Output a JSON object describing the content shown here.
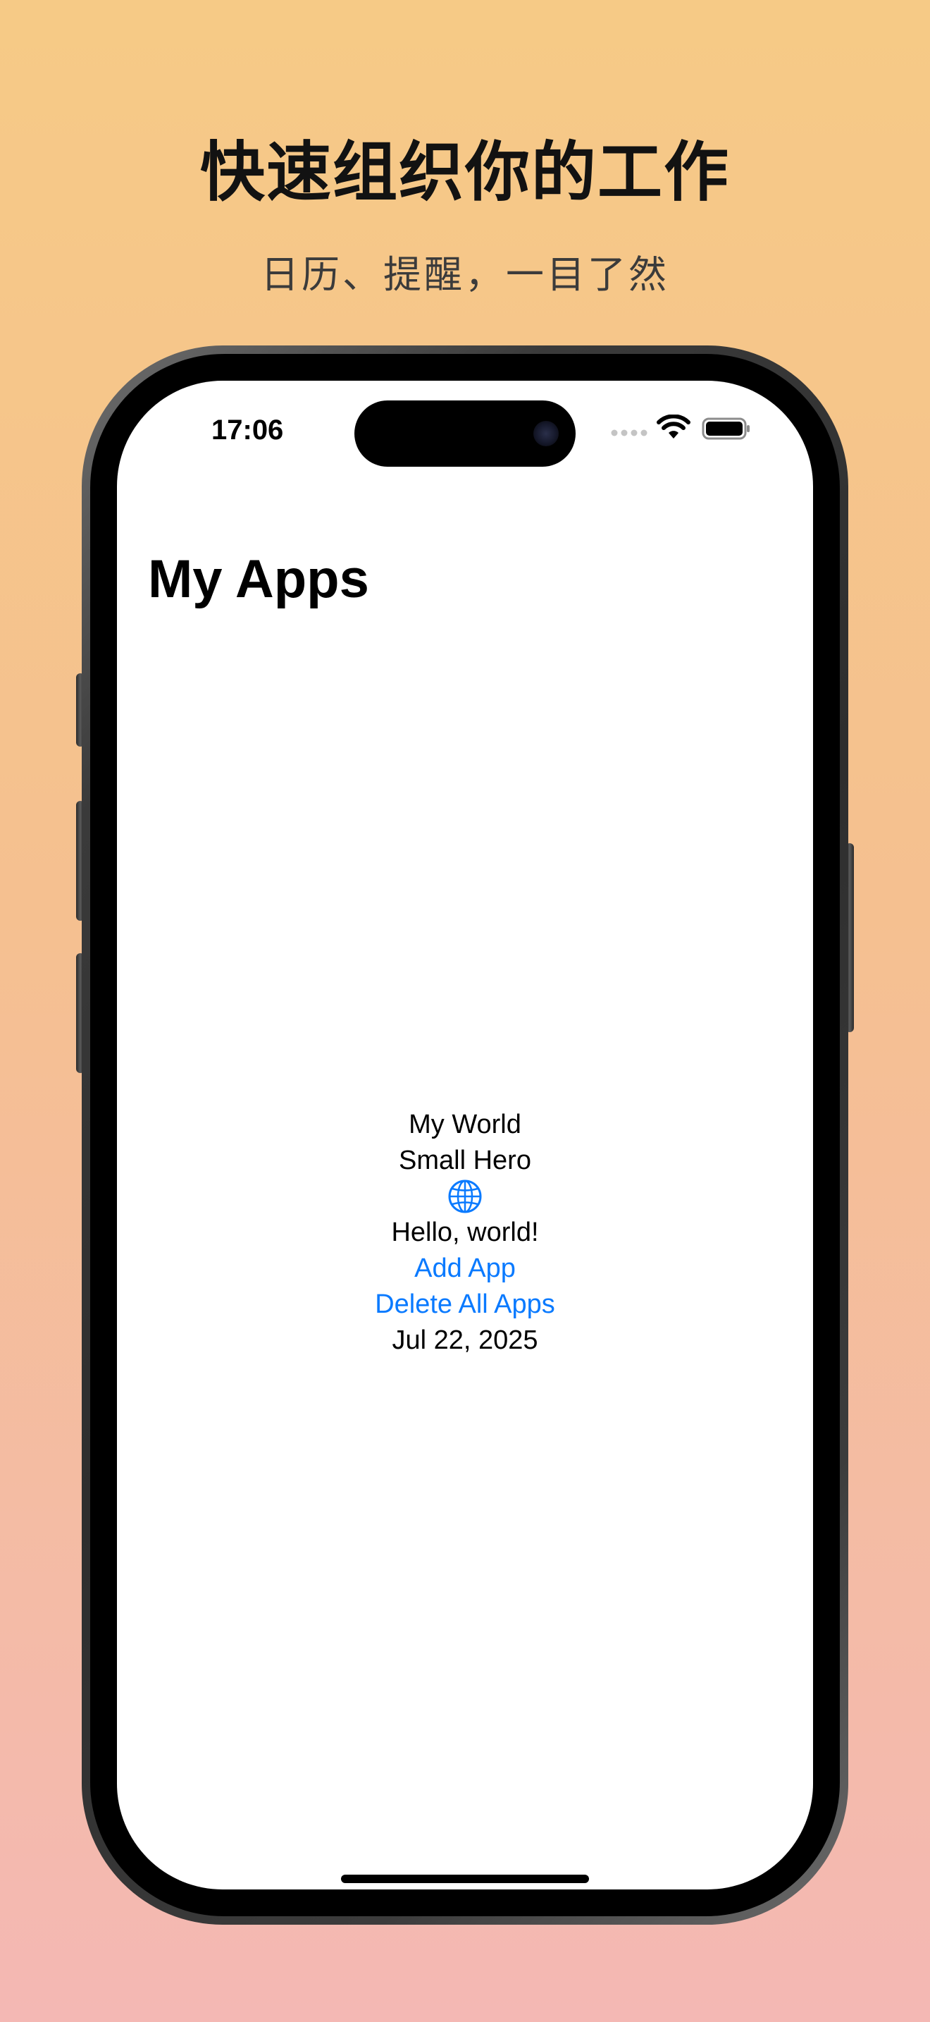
{
  "promo": {
    "headline": "快速组织你的工作",
    "subheadline": "日历、提醒，一目了然"
  },
  "status_bar": {
    "time": "17:06",
    "icons": [
      "signal-icon",
      "wifi-icon",
      "battery-icon"
    ]
  },
  "nav": {
    "title": "My Apps"
  },
  "content": {
    "world_name": "My World",
    "hero_name": "Small Hero",
    "icon": "globe-icon",
    "greeting": "Hello, world!",
    "add_label": "Add App",
    "delete_label": "Delete All Apps",
    "date": "Jul 22, 2025"
  },
  "colors": {
    "background_top": "#f6ca86",
    "background_bottom": "#f4b8b4",
    "accent": "#0a7aff",
    "text": "#000000"
  }
}
